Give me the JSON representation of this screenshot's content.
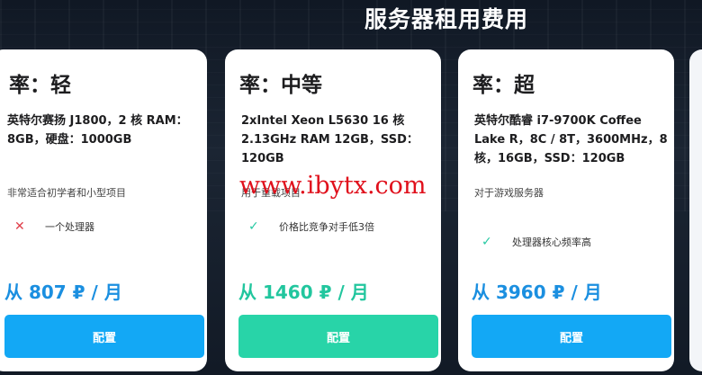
{
  "page": {
    "title": "服务器租用费用"
  },
  "plans": [
    {
      "tier": "率：轻",
      "spec": "英特尔赛扬 J1800，2 核 RAM：8GB，硬盘：1000GB",
      "description": "非常适合初学者和小型项目",
      "feature": {
        "icon": "cross-icon",
        "text": "一个处理器"
      },
      "price": "从 807 ₽ / 月",
      "button": "配置",
      "accent": "#1b8fe0"
    },
    {
      "tier": "率：中等",
      "spec": "2xIntel Xeon L5630 16 核 2.13GHz RAM 12GB，SSD：120GB",
      "description": "用于重载项目",
      "feature": {
        "icon": "check-icon",
        "text": "价格比竞争对手低3倍"
      },
      "price": "从 1460 ₽ / 月",
      "button": "配置",
      "accent": "#22c69e"
    },
    {
      "tier": "率：超",
      "spec": "英特尔酷睿 i7-9700K Coffee Lake R，8C / 8T，3600MHz，8 核，16GB，SSD：120GB",
      "description": "对于游戏服务器",
      "feature": {
        "icon": "check-icon",
        "text": "处理器核心频率高"
      },
      "price": "从 3960 ₽ / 月",
      "button": "配置",
      "accent": "#1b8fe0"
    }
  ],
  "watermark": "www.ibytx.com"
}
